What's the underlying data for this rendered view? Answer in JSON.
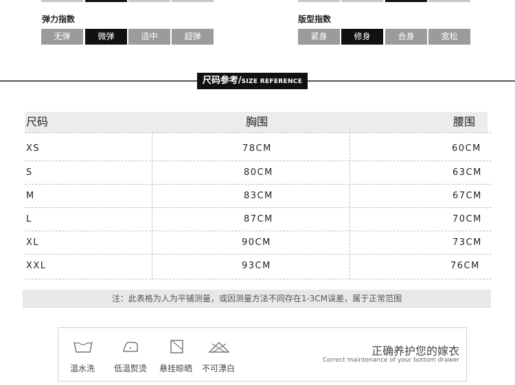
{
  "elasticity": {
    "title": "弹力指数",
    "options": [
      "无弹",
      "微弹",
      "适中",
      "超弹"
    ],
    "selected": "微弹"
  },
  "fit": {
    "title": "版型指数",
    "options": [
      "紧身",
      "修身",
      "合身",
      "宽松"
    ],
    "selected": "修身"
  },
  "size_reference": {
    "title_cn": "尺码参考/",
    "title_en": "SIZE REFERENCE"
  },
  "table": {
    "headers": [
      "尺码",
      "胸围",
      "腰围"
    ],
    "rows": [
      [
        "XS",
        "78CM",
        "60CM"
      ],
      [
        "S",
        "80CM",
        "63CM"
      ],
      [
        "M",
        "83CM",
        "67CM"
      ],
      [
        "L",
        "87CM",
        "70CM"
      ],
      [
        "XL",
        "90CM",
        "73CM"
      ],
      [
        "XXL",
        "93CM",
        "76CM"
      ]
    ]
  },
  "note": "注：此表格为人为平铺测量，或因测量方法不同存在1-3CM误差，属于正常范围",
  "care": {
    "title": "正确养护您的嫁衣",
    "subtitle": "Correct maintenance of your bottom drawer",
    "items": [
      {
        "icon": "warm-wash-icon",
        "label": "温水洗"
      },
      {
        "icon": "low-iron-icon",
        "label": "低温熨烫"
      },
      {
        "icon": "hang-dry-icon",
        "label": "悬挂晾晒"
      },
      {
        "icon": "no-bleach-icon",
        "label": "不可漂白"
      }
    ]
  },
  "colors": {
    "selected": "#111111",
    "unselected": "#9b9b9b",
    "header_bg": "#ececec"
  }
}
